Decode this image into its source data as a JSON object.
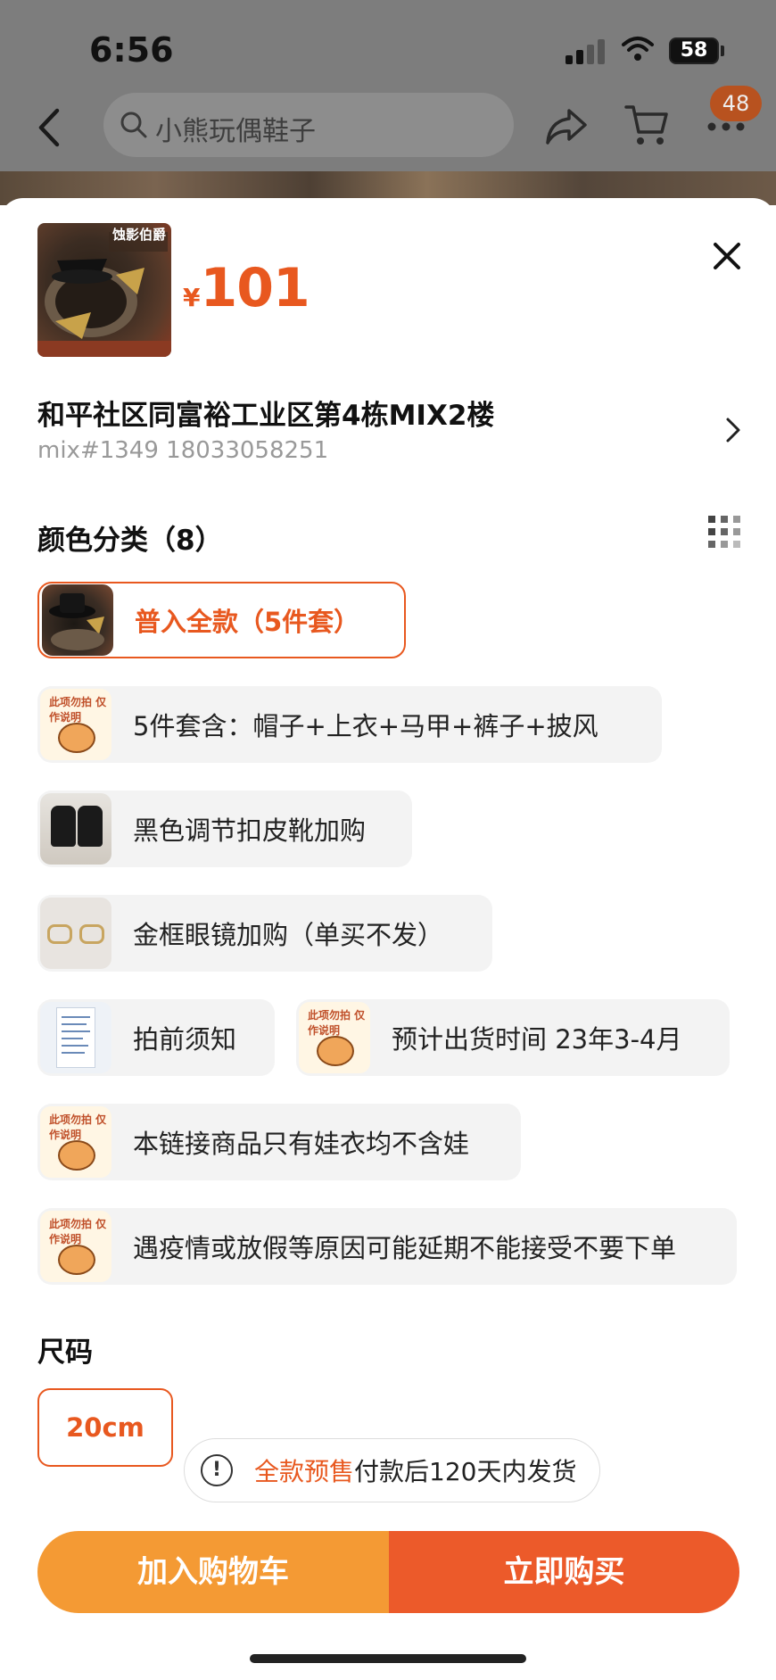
{
  "status_bar": {
    "time": "6:56",
    "battery": "58"
  },
  "nav": {
    "search_placeholder": "小熊玩偶鞋子",
    "badge": "48"
  },
  "product": {
    "currency": "¥",
    "price": "101",
    "thumb_caption": "蚀影伯爵"
  },
  "address": {
    "line1": "和平社区同富裕工业区第4栋MIX2楼",
    "line2": "mix#1349 18033058251"
  },
  "color_section": {
    "title": "颜色分类（8）",
    "options": [
      {
        "label": "普入全款（5件套）",
        "selected": true,
        "icon": "hat-outfit-thumbnail"
      },
      {
        "label": "5件套含：帽子+上衣+马甲+裤子+披风",
        "selected": false,
        "icon": "tiger-note-thumbnail"
      },
      {
        "label": "黑色调节扣皮靴加购",
        "selected": false,
        "icon": "black-boots-thumbnail"
      },
      {
        "label": "金框眼镜加购（单买不发）",
        "selected": false,
        "icon": "gold-glasses-thumbnail"
      },
      {
        "label": "拍前须知",
        "selected": false,
        "icon": "document-thumbnail"
      },
      {
        "label": "预计出货时间 23年3-4月",
        "selected": false,
        "icon": "tiger-note-thumbnail"
      },
      {
        "label": "本链接商品只有娃衣均不含娃",
        "selected": false,
        "icon": "tiger-note-thumbnail"
      },
      {
        "label": "遇疫情或放假等原因可能延期不能接受不要下单",
        "selected": false,
        "icon": "tiger-note-thumbnail"
      }
    ],
    "tiger_note_text": "此项勿拍 仅作说明"
  },
  "size_section": {
    "title": "尺码",
    "options": [
      {
        "label": "20cm",
        "selected": true
      }
    ]
  },
  "presale": {
    "highlight": "全款预售",
    "text": "付款后120天内发货"
  },
  "actions": {
    "add_to_cart": "加入购物车",
    "buy_now": "立即购买"
  },
  "colors": {
    "accent": "#e8581f",
    "cart_button": "#f49a34",
    "buy_button": "#ec5a2a"
  }
}
